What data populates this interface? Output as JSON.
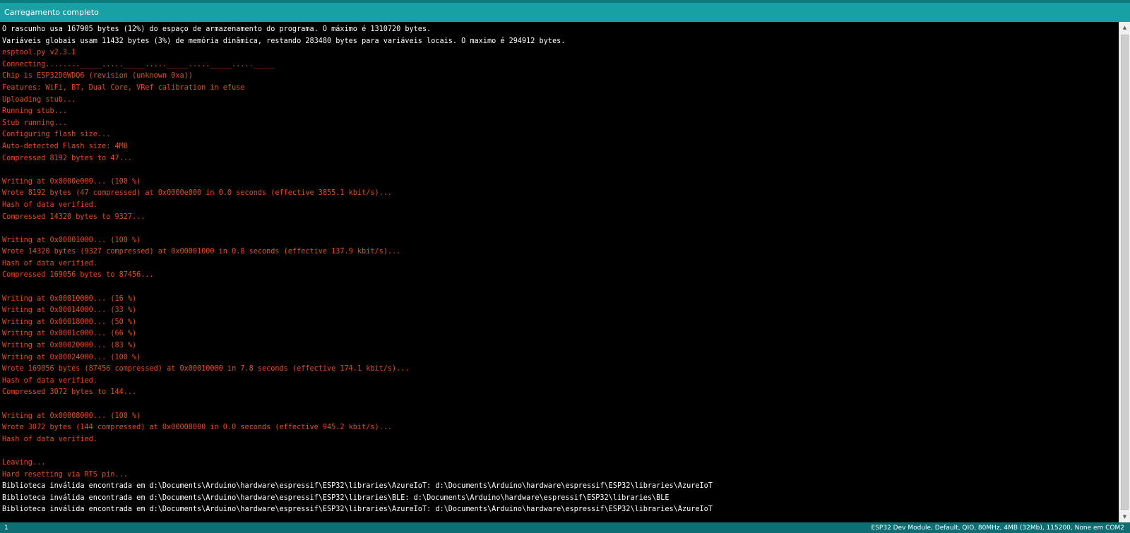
{
  "status": {
    "message": "Carregamento completo"
  },
  "console": {
    "lines": [
      {
        "text": "O rascunho usa 167905 bytes (12%) do espaço de armazenamento do programa. O máximo é 1310720 bytes.",
        "color": "white"
      },
      {
        "text": "Variáveis globais usam 11432 bytes (3%) de memória dinâmica, restando 283480 bytes para variáveis locais. O maximo é 294912 bytes.",
        "color": "white"
      },
      {
        "text": "esptool.py v2.3.1",
        "color": "orange"
      },
      {
        "text": "Connecting........_____....._____....._____....._____....._____",
        "color": "orange"
      },
      {
        "text": "Chip is ESP32D0WDQ6 (revision (unknown 0xa))",
        "color": "orange"
      },
      {
        "text": "Features: WiFi, BT, Dual Core, VRef calibration in efuse",
        "color": "orange"
      },
      {
        "text": "Uploading stub...",
        "color": "orange"
      },
      {
        "text": "Running stub...",
        "color": "orange"
      },
      {
        "text": "Stub running...",
        "color": "orange"
      },
      {
        "text": "Configuring flash size...",
        "color": "orange"
      },
      {
        "text": "Auto-detected Flash size: 4MB",
        "color": "orange"
      },
      {
        "text": "Compressed 8192 bytes to 47...",
        "color": "orange"
      },
      {
        "text": "",
        "color": "orange"
      },
      {
        "text": "Writing at 0x0000e000... (100 %)",
        "color": "orange"
      },
      {
        "text": "Wrote 8192 bytes (47 compressed) at 0x0000e000 in 0.0 seconds (effective 3855.1 kbit/s)...",
        "color": "orange"
      },
      {
        "text": "Hash of data verified.",
        "color": "orange"
      },
      {
        "text": "Compressed 14320 bytes to 9327...",
        "color": "orange"
      },
      {
        "text": "",
        "color": "orange"
      },
      {
        "text": "Writing at 0x00001000... (100 %)",
        "color": "orange"
      },
      {
        "text": "Wrote 14320 bytes (9327 compressed) at 0x00001000 in 0.8 seconds (effective 137.9 kbit/s)...",
        "color": "orange"
      },
      {
        "text": "Hash of data verified.",
        "color": "orange"
      },
      {
        "text": "Compressed 169056 bytes to 87456...",
        "color": "orange"
      },
      {
        "text": "",
        "color": "orange"
      },
      {
        "text": "Writing at 0x00010000... (16 %)",
        "color": "orange"
      },
      {
        "text": "Writing at 0x00014000... (33 %)",
        "color": "orange"
      },
      {
        "text": "Writing at 0x00018000... (50 %)",
        "color": "orange"
      },
      {
        "text": "Writing at 0x0001c000... (66 %)",
        "color": "orange"
      },
      {
        "text": "Writing at 0x00020000... (83 %)",
        "color": "orange"
      },
      {
        "text": "Writing at 0x00024000... (100 %)",
        "color": "orange"
      },
      {
        "text": "Wrote 169056 bytes (87456 compressed) at 0x00010000 in 7.8 seconds (effective 174.1 kbit/s)...",
        "color": "orange"
      },
      {
        "text": "Hash of data verified.",
        "color": "orange"
      },
      {
        "text": "Compressed 3072 bytes to 144...",
        "color": "orange"
      },
      {
        "text": "",
        "color": "orange"
      },
      {
        "text": "Writing at 0x00008000... (100 %)",
        "color": "orange"
      },
      {
        "text": "Wrote 3072 bytes (144 compressed) at 0x00008000 in 0.0 seconds (effective 945.2 kbit/s)...",
        "color": "orange"
      },
      {
        "text": "Hash of data verified.",
        "color": "orange"
      },
      {
        "text": "",
        "color": "orange"
      },
      {
        "text": "Leaving...",
        "color": "orange"
      },
      {
        "text": "Hard resetting via RTS pin...",
        "color": "orange"
      },
      {
        "text": "Biblioteca inválida encontrada em d:\\Documents\\Arduino\\hardware\\espressif\\ESP32\\libraries\\AzureIoT: d:\\Documents\\Arduino\\hardware\\espressif\\ESP32\\libraries\\AzureIoT",
        "color": "white"
      },
      {
        "text": "Biblioteca inválida encontrada em d:\\Documents\\Arduino\\hardware\\espressif\\ESP32\\libraries\\BLE: d:\\Documents\\Arduino\\hardware\\espressif\\ESP32\\libraries\\BLE",
        "color": "white"
      },
      {
        "text": "Biblioteca inválida encontrada em d:\\Documents\\Arduino\\hardware\\espressif\\ESP32\\libraries\\AzureIoT: d:\\Documents\\Arduino\\hardware\\espressif\\ESP32\\libraries\\AzureIoT",
        "color": "white"
      }
    ]
  },
  "footer": {
    "line_number": "1",
    "board_info": "ESP32 Dev Module, Default, QIO, 80MHz, 4MB (32Mb), 115200, None em COM2"
  },
  "colors": {
    "status_bar": "#17a1a5",
    "footer_bar": "#0d6e73",
    "console_bg": "#000000",
    "text_white": "#ffffff",
    "text_orange": "#e34c1f"
  },
  "icons": {
    "scroll_up": "chevron-up-icon",
    "scroll_down": "chevron-down-icon"
  }
}
